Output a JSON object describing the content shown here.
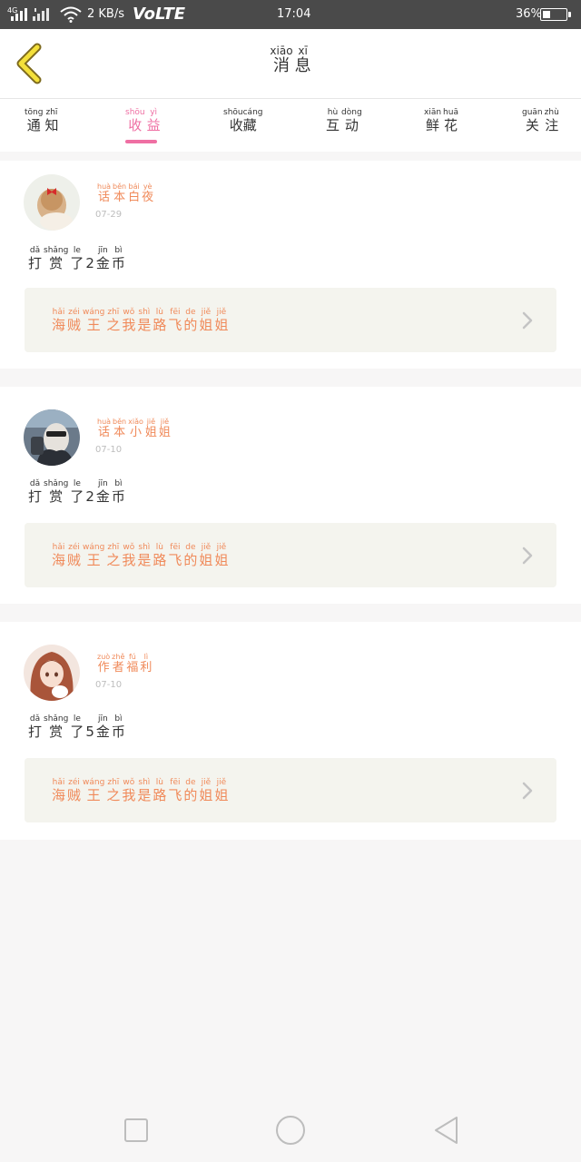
{
  "status_bar": {
    "network_4g": "4G",
    "net_speed": "2 KB/s",
    "volte": "VoLTE",
    "time": "17:04",
    "battery": "36%",
    "battery_level": 0.36,
    "icons": [
      "signal-icon",
      "signal-x-icon",
      "wifi-icon",
      "battery-icon"
    ]
  },
  "header": {
    "title_chars": [
      {
        "py": "xiāo",
        "hz": "消"
      },
      {
        "py": "xī",
        "hz": "息"
      }
    ],
    "back_icon": "chevron-left-icon"
  },
  "tabs": [
    {
      "chars": [
        {
          "py": "tōng",
          "hz": "通"
        },
        {
          "py": "zhī",
          "hz": "知"
        }
      ],
      "active": false
    },
    {
      "chars": [
        {
          "py": "shōu",
          "hz": "收"
        },
        {
          "py": "yì",
          "hz": "益"
        }
      ],
      "active": true
    },
    {
      "chars": [
        {
          "py": "shōucáng",
          "hz": "收藏",
          "wide": true
        }
      ],
      "active": false
    },
    {
      "chars": [
        {
          "py": "hù",
          "hz": "互"
        },
        {
          "py": "dòng",
          "hz": "动"
        }
      ],
      "active": false
    },
    {
      "chars": [
        {
          "py": "xiān",
          "hz": "鲜"
        },
        {
          "py": "huā",
          "hz": "花"
        }
      ],
      "active": false
    },
    {
      "chars": [
        {
          "py": "guān",
          "hz": "关"
        },
        {
          "py": "zhù",
          "hz": "注"
        }
      ],
      "active": false
    }
  ],
  "colors": {
    "accent_pink": "#ef6fa3",
    "orange_text": "#f08a5a",
    "status_bar": "#4a4a4a",
    "book_box": "#f4f4ee"
  },
  "messages": [
    {
      "author_chars": [
        {
          "py": "huà",
          "hz": "话"
        },
        {
          "py": "běn",
          "hz": "本"
        },
        {
          "py": "bái",
          "hz": "白"
        },
        {
          "py": "yè",
          "hz": "夜"
        }
      ],
      "date": "07-29",
      "action_chars": [
        {
          "py": "dǎ",
          "hz": "打"
        },
        {
          "py": "shǎng",
          "hz": "赏"
        },
        {
          "py": "le",
          "hz": "了"
        },
        {
          "py": "",
          "hz": "2"
        },
        {
          "py": "jīn",
          "hz": "金"
        },
        {
          "py": "bì",
          "hz": "币"
        }
      ],
      "book_chars": [
        {
          "py": "hǎi",
          "hz": "海"
        },
        {
          "py": "zéi",
          "hz": "贼"
        },
        {
          "py": "wáng",
          "hz": "王"
        },
        {
          "py": "zhī",
          "hz": "之"
        },
        {
          "py": "wǒ",
          "hz": "我"
        },
        {
          "py": "shì",
          "hz": "是"
        },
        {
          "py": "lù",
          "hz": "路"
        },
        {
          "py": "fēi",
          "hz": "飞"
        },
        {
          "py": "de",
          "hz": "的"
        },
        {
          "py": "jiě",
          "hz": "姐"
        },
        {
          "py": "jiě",
          "hz": "姐"
        }
      ],
      "avatar": "avatar-girl-red-bow"
    },
    {
      "author_chars": [
        {
          "py": "huà",
          "hz": "话"
        },
        {
          "py": "běn",
          "hz": "本"
        },
        {
          "py": "xiǎo",
          "hz": "小"
        },
        {
          "py": "jiě",
          "hz": "姐"
        },
        {
          "py": "jiě",
          "hz": "姐"
        }
      ],
      "date": "07-10",
      "action_chars": [
        {
          "py": "dǎ",
          "hz": "打"
        },
        {
          "py": "shǎng",
          "hz": "赏"
        },
        {
          "py": "le",
          "hz": "了"
        },
        {
          "py": "",
          "hz": "2"
        },
        {
          "py": "jīn",
          "hz": "金"
        },
        {
          "py": "bì",
          "hz": "币"
        }
      ],
      "book_chars": [
        {
          "py": "hǎi",
          "hz": "海"
        },
        {
          "py": "zéi",
          "hz": "贼"
        },
        {
          "py": "wáng",
          "hz": "王"
        },
        {
          "py": "zhī",
          "hz": "之"
        },
        {
          "py": "wǒ",
          "hz": "我"
        },
        {
          "py": "shì",
          "hz": "是"
        },
        {
          "py": "lù",
          "hz": "路"
        },
        {
          "py": "fēi",
          "hz": "飞"
        },
        {
          "py": "de",
          "hz": "的"
        },
        {
          "py": "jiě",
          "hz": "姐"
        },
        {
          "py": "jiě",
          "hz": "姐"
        }
      ],
      "avatar": "avatar-man-sunglasses"
    },
    {
      "author_chars": [
        {
          "py": "zuò",
          "hz": "作"
        },
        {
          "py": "zhě",
          "hz": "者"
        },
        {
          "py": "fú",
          "hz": "福"
        },
        {
          "py": "lì",
          "hz": "利"
        }
      ],
      "date": "07-10",
      "action_chars": [
        {
          "py": "dǎ",
          "hz": "打"
        },
        {
          "py": "shǎng",
          "hz": "赏"
        },
        {
          "py": "le",
          "hz": "了"
        },
        {
          "py": "",
          "hz": "5"
        },
        {
          "py": "jīn",
          "hz": "金"
        },
        {
          "py": "bì",
          "hz": "币"
        }
      ],
      "book_chars": [
        {
          "py": "hǎi",
          "hz": "海"
        },
        {
          "py": "zéi",
          "hz": "贼"
        },
        {
          "py": "wáng",
          "hz": "王"
        },
        {
          "py": "zhī",
          "hz": "之"
        },
        {
          "py": "wǒ",
          "hz": "我"
        },
        {
          "py": "shì",
          "hz": "是"
        },
        {
          "py": "lù",
          "hz": "路"
        },
        {
          "py": "fēi",
          "hz": "飞"
        },
        {
          "py": "de",
          "hz": "的"
        },
        {
          "py": "jiě",
          "hz": "姐"
        },
        {
          "py": "jiě",
          "hz": "姐"
        }
      ],
      "avatar": "avatar-anime-girl"
    }
  ],
  "navbar": [
    "recents-square-icon",
    "home-circle-icon",
    "back-triangle-icon"
  ]
}
